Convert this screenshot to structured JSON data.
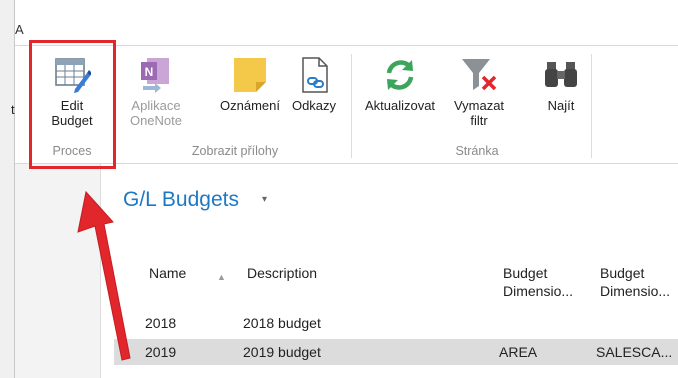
{
  "ribbon_tab": {
    "label": "A"
  },
  "ribbon": {
    "cut_label": "t",
    "edit_budget_label": "Edit\nBudget",
    "group_proces": "Proces",
    "onenote_label": "Aplikace\nOneNote",
    "notes_label": "Oznámení",
    "links_label": "Odkazy",
    "group_attachments": "Zobrazit přílohy",
    "refresh_label": "Aktualizovat",
    "clear_filter_label": "Vymazat\nfiltr",
    "find_label": "Najít",
    "group_page": "Stránka"
  },
  "page": {
    "title": "G/L Budgets",
    "title_caret": "▾"
  },
  "table": {
    "headers": {
      "name": "Name",
      "description": "Description",
      "dim1": "Budget\nDimensio...",
      "dim2": "Budget\nDimensio..."
    },
    "sort_indicator": "▲",
    "rows": [
      {
        "name": "2018",
        "description": "2018 budget",
        "dim1": "",
        "dim2": ""
      },
      {
        "name": "2019",
        "description": "2019 budget",
        "dim1": "AREA",
        "dim2": "SALESCA..."
      }
    ]
  },
  "colors": {
    "highlight": "#e1262c",
    "title": "#1e79c5",
    "selected_row": "#dcdcdc",
    "arrow": "#e1262c"
  }
}
